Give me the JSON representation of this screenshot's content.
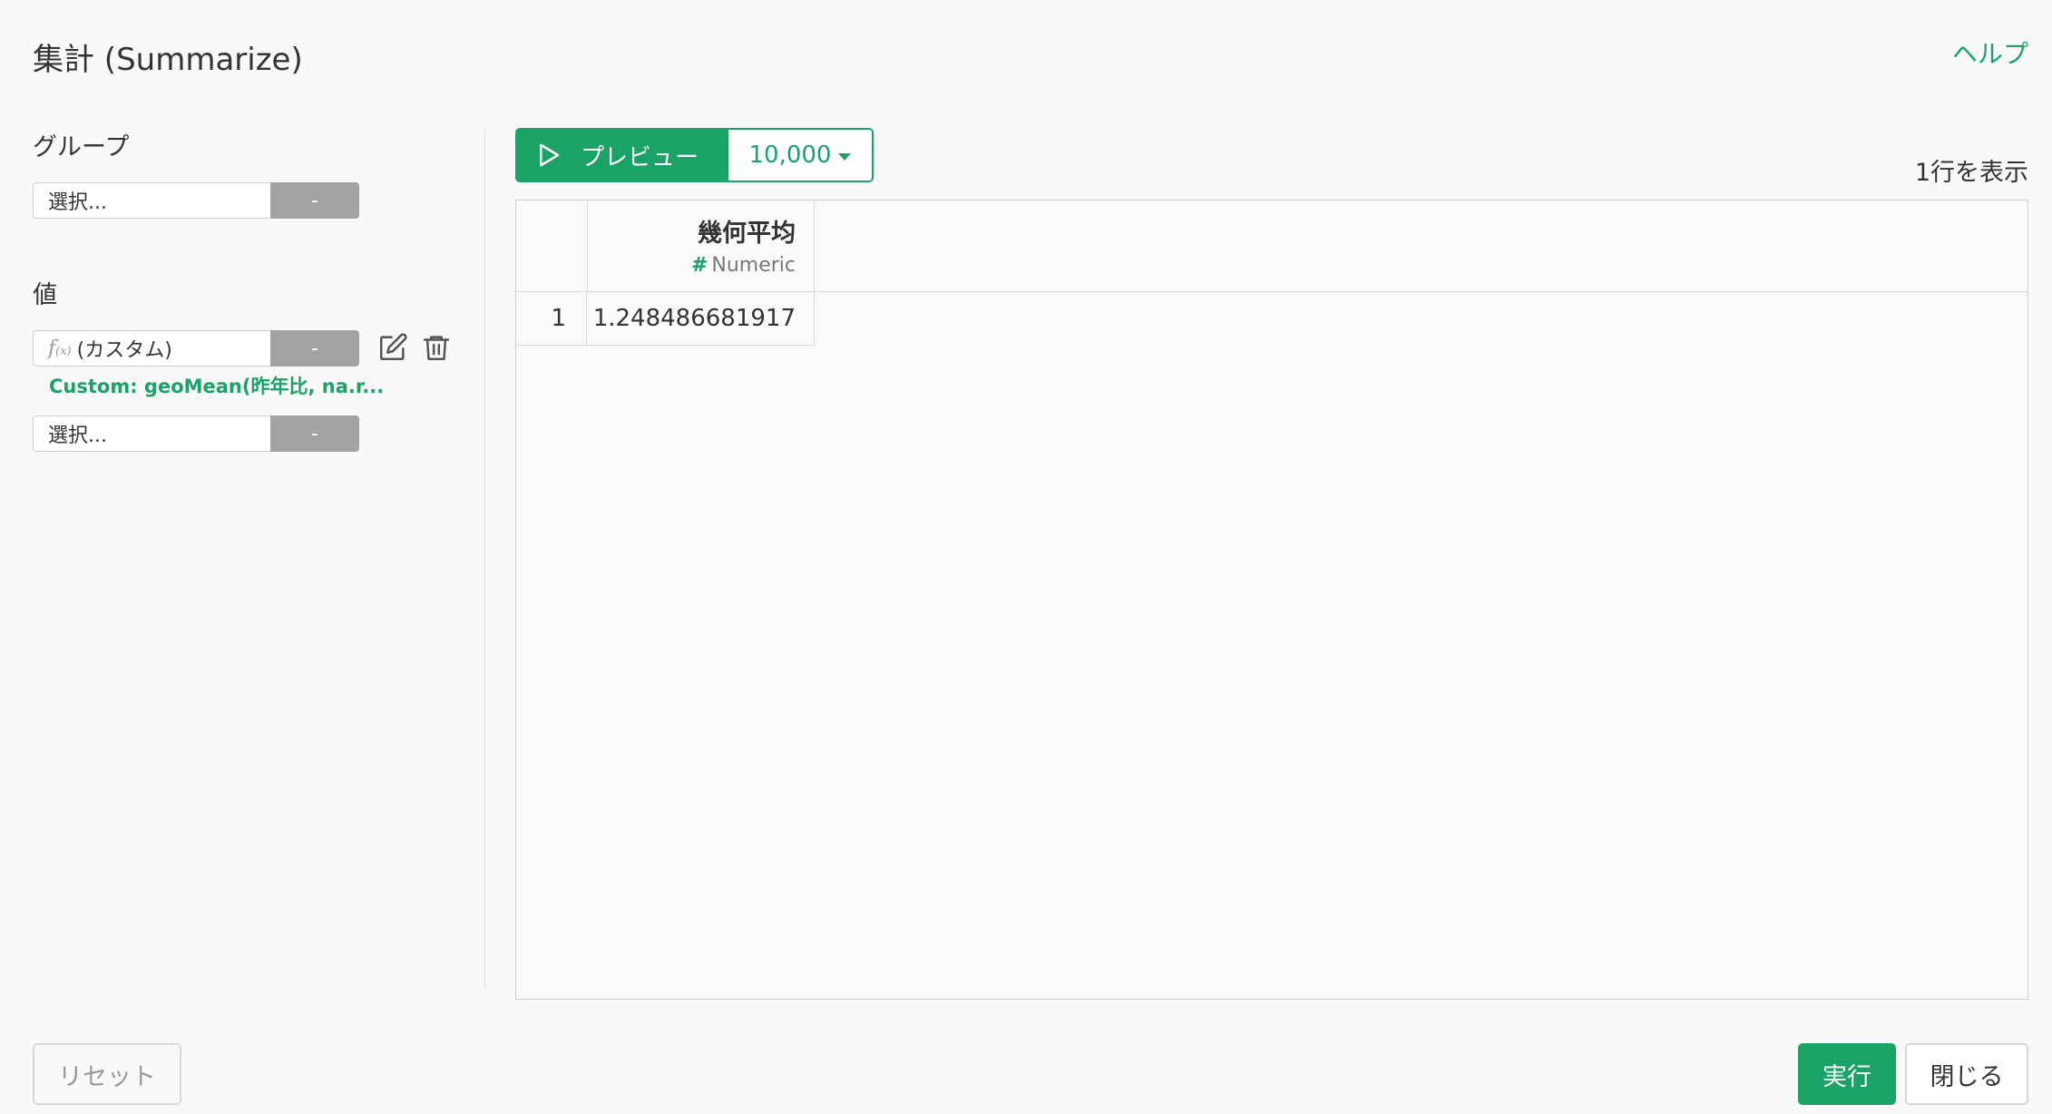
{
  "header": {
    "title": "集計 (Summarize)",
    "help_label": "ヘルプ"
  },
  "group": {
    "label": "グループ",
    "select_placeholder": "選択...",
    "remove_label": "-"
  },
  "value": {
    "label": "値",
    "items": [
      {
        "fx_label": "f",
        "fx_sub": "(x)",
        "name": "(カスタム)",
        "remove_label": "-",
        "description": "Custom: geoMean(昨年比, na.r..."
      }
    ],
    "new_select_placeholder": "選択...",
    "new_remove_label": "-"
  },
  "toolbar": {
    "preview_label": "プレビュー",
    "row_limit": "10,000",
    "rows_shown": "1行を表示"
  },
  "table": {
    "columns": [
      {
        "name": "幾何平均",
        "type_icon": "#",
        "type": "Numeric"
      }
    ],
    "rows": [
      {
        "index": "1",
        "values": [
          "1.248486681917"
        ]
      }
    ]
  },
  "footer": {
    "reset_label": "リセット",
    "run_label": "実行",
    "close_label": "閉じる"
  },
  "colors": {
    "accent": "#1aa267",
    "gray_button": "#a3a3a3"
  }
}
